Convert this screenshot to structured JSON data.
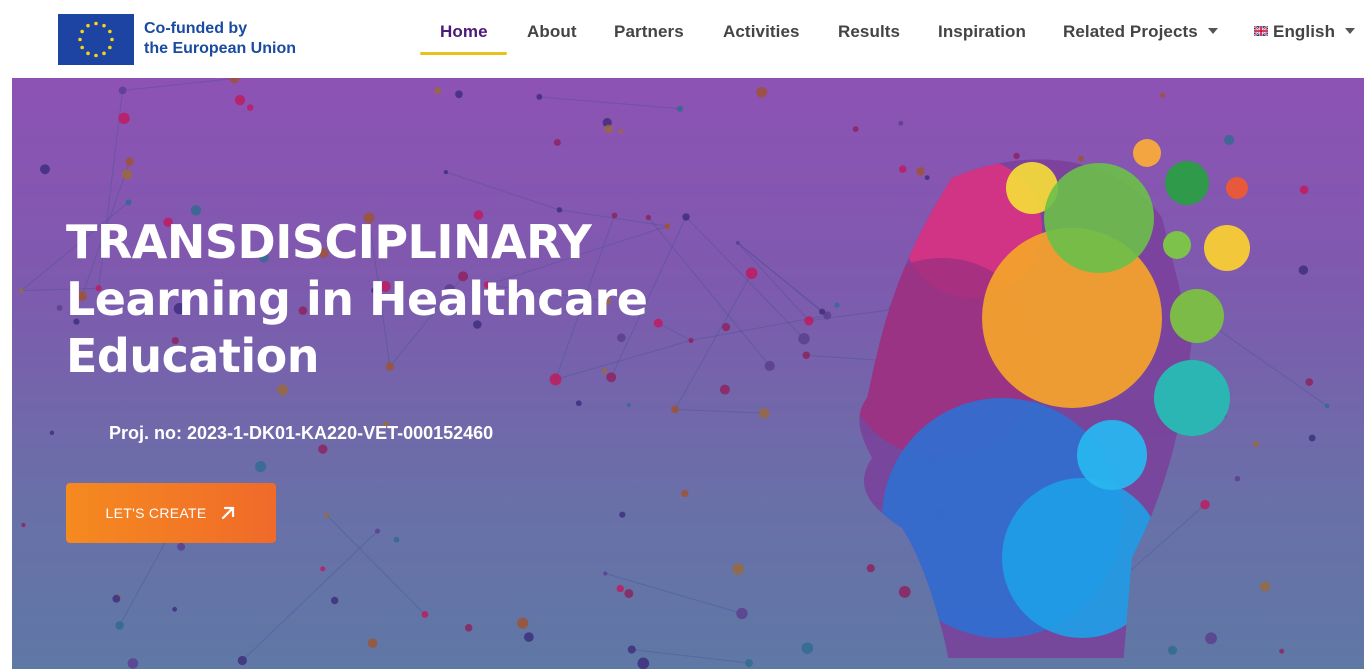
{
  "header": {
    "eu_line1": "Co-funded by",
    "eu_line2": "the European Union"
  },
  "nav": {
    "items": [
      {
        "label": "Home"
      },
      {
        "label": "About"
      },
      {
        "label": "Partners"
      },
      {
        "label": "Activities"
      },
      {
        "label": "Results"
      },
      {
        "label": "Inspiration"
      },
      {
        "label": "Related Projects"
      },
      {
        "label": "English"
      }
    ],
    "active_index": 0
  },
  "hero": {
    "title_line1": "TRANSDISCIPLINARY",
    "title_line2": "Learning in Healthcare",
    "title_line3": "Education",
    "project_number": "Proj. no: 2023-1-DK01-KA220-VET-000152460",
    "cta_label": "LET'S CREATE"
  },
  "colors": {
    "eu_blue": "#1a4ba0",
    "active_nav": "#4b1a78",
    "underline": "#e7c21b",
    "cta": "#f27c24"
  },
  "icons": [
    "eu-flag-icon",
    "caret-down-icon",
    "uk-flag-icon",
    "arrow-up-right-icon"
  ]
}
